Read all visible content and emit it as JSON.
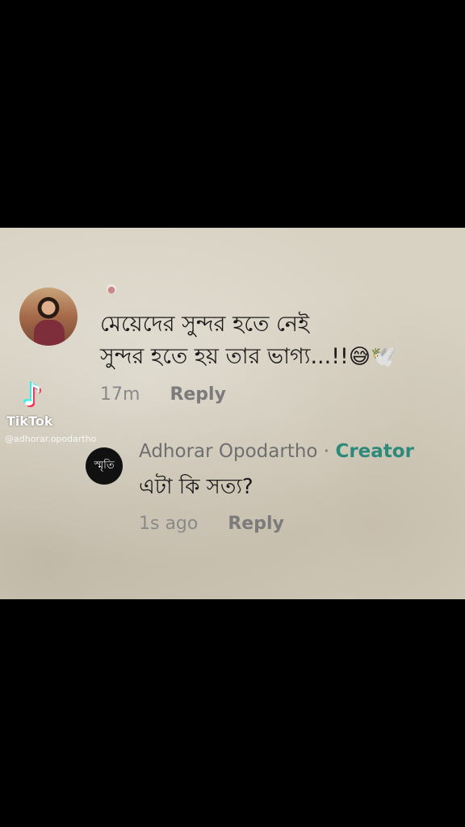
{
  "comment": {
    "line1": "মেয়েদের সুন্দর হতে নেই",
    "line2": "সুন্দর হতে হয় তার ভাগ্য...!!",
    "emoji": "😅🕊️",
    "time": "17m",
    "reply_label": "Reply"
  },
  "watermark": {
    "logo_text": "TikTok",
    "handle": "@adhorar.opodartho"
  },
  "reply": {
    "avatar_text": "স্মৃতি",
    "author": "Adhorar Opodartho",
    "separator": " · ",
    "badge": "Creator",
    "text": "এটা কি সত্য?",
    "time": "1s ago",
    "reply_label": "Reply"
  }
}
